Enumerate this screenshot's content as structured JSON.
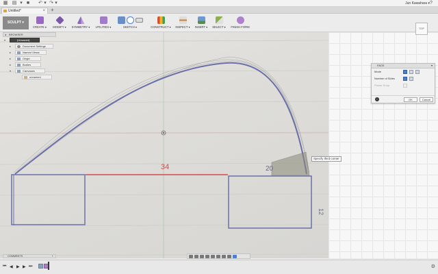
{
  "app": {
    "user_name": "Jun Kawahara ▾",
    "help_icon": "question-icon"
  },
  "tabs": {
    "doc_title": "Untitled*"
  },
  "ribbon": {
    "workspace": "SCULPT ▾",
    "groups": [
      {
        "label": "CREATE ▾"
      },
      {
        "label": "MODIFY ▾"
      },
      {
        "label": "SYMMETRY ▾"
      },
      {
        "label": "UTILITIES ▾"
      },
      {
        "label": "SKETCH ▾"
      },
      {
        "label": "CONSTRUCT ▾"
      },
      {
        "label": "INSPECT ▾"
      },
      {
        "label": "INSERT ▾"
      },
      {
        "label": "SELECT ▾"
      },
      {
        "label": "FINISH FORM"
      }
    ]
  },
  "browser": {
    "title": "BROWSER",
    "items": [
      {
        "label": "(Unsaved)"
      },
      {
        "label": "Document Settings"
      },
      {
        "label": "Named Views"
      },
      {
        "label": "Origin"
      },
      {
        "label": "Bodies"
      },
      {
        "label": "Canvases"
      },
      {
        "label": "unnamed"
      }
    ]
  },
  "viewcube": {
    "label": "TOP"
  },
  "canvas": {
    "annotations": [
      {
        "text": "34"
      },
      {
        "text": "20"
      },
      {
        "text": "12"
      }
    ]
  },
  "tooltip": {
    "text": "Specify third corner"
  },
  "dialog": {
    "title": "FACE",
    "rows": [
      {
        "label": "Mode"
      },
      {
        "label": "Number of Sides"
      },
      {
        "label": "Planar Snap"
      }
    ],
    "ok_label": "OK",
    "cancel_label": "Cancel"
  },
  "comments": {
    "title": "COMMENTS"
  },
  "colors": {
    "sketch_line": "#6a6fa8",
    "dimension_red": "#d44a4a",
    "selection_fill": "#8a8a78"
  }
}
